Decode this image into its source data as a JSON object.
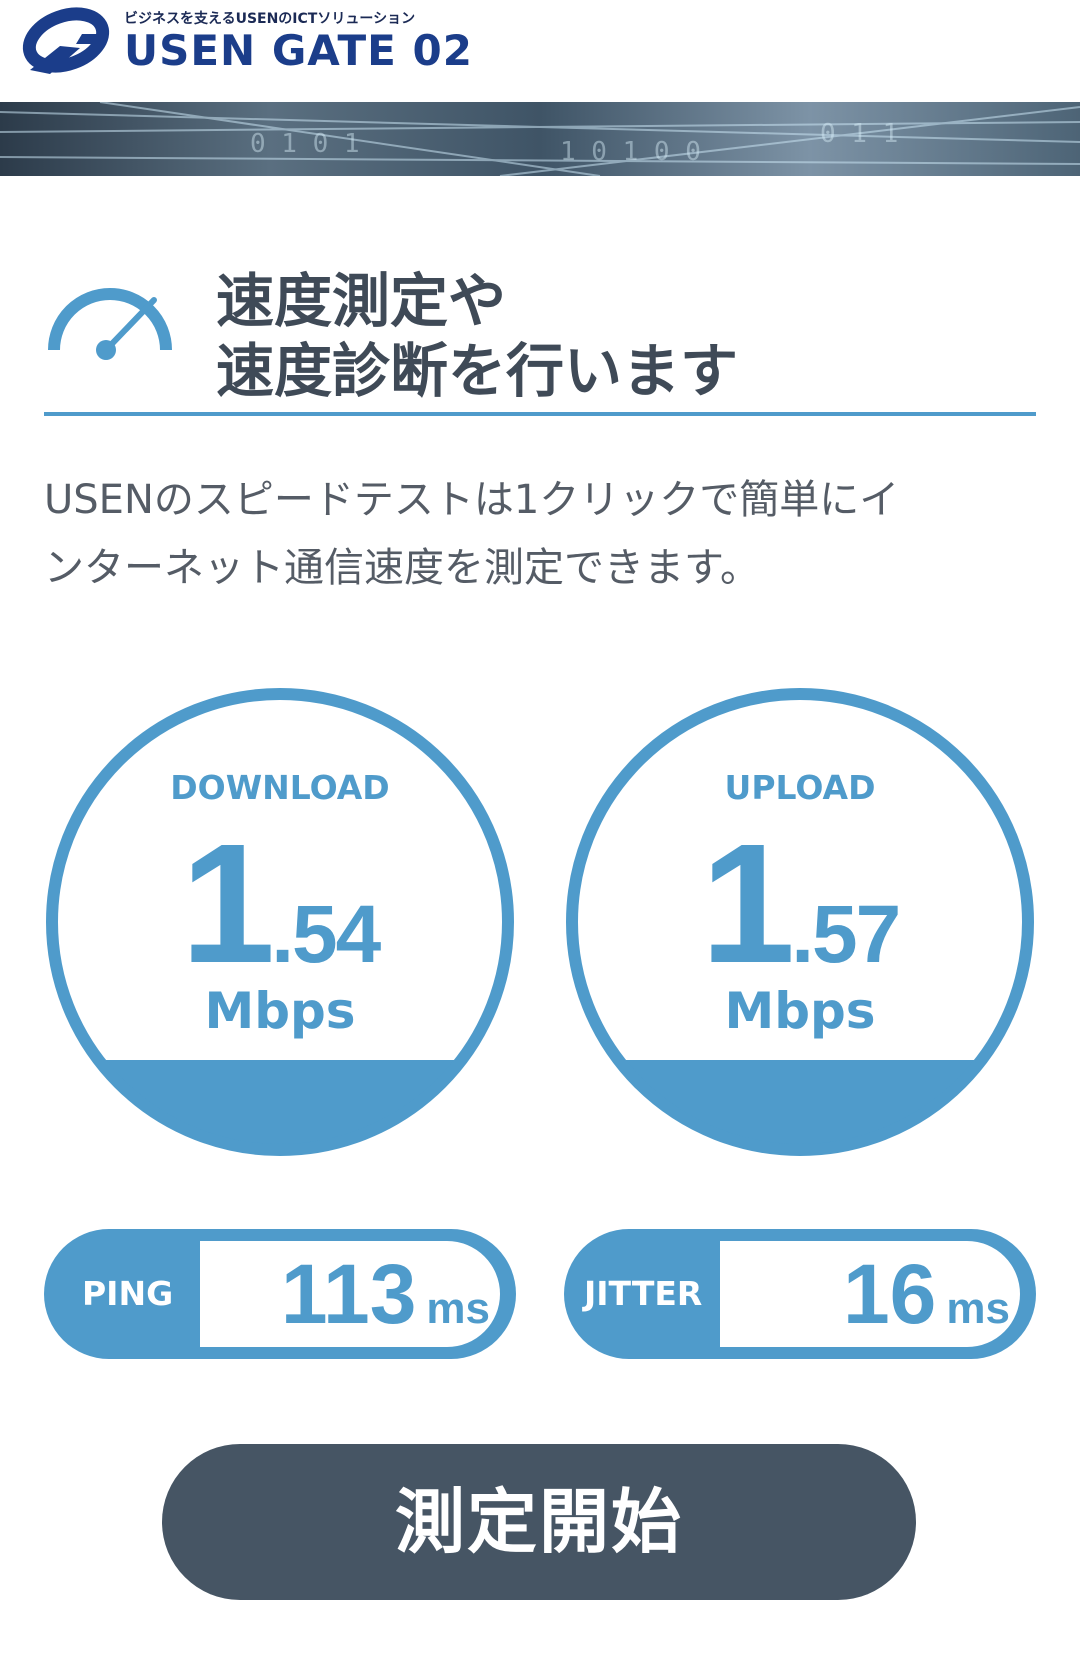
{
  "header": {
    "tagline": "ビジネスを支えるUSENのICTソリューション",
    "brand": "USEN GATE 02"
  },
  "section": {
    "title_line1": "速度測定や",
    "title_line2": "速度診断を行います",
    "description_line1": "USENのスピードテストは1クリックで簡単にイ",
    "description_line2": "ンターネット通信速度を測定できます。"
  },
  "download": {
    "label": "DOWNLOAD",
    "value_int": "1",
    "value_dec": ".54",
    "unit": "Mbps"
  },
  "upload": {
    "label": "UPLOAD",
    "value_int": "1",
    "value_dec": ".57",
    "unit": "Mbps"
  },
  "ping": {
    "label": "PING",
    "value": "113",
    "unit": "ms"
  },
  "jitter": {
    "label": "JITTER",
    "value": "16",
    "unit": "ms"
  },
  "start_button": {
    "label": "測定開始"
  },
  "colors": {
    "accent": "#4f9bcb",
    "button": "#465564",
    "text": "#3f4a57"
  },
  "icons": {
    "logo": "usen-logo-icon",
    "speedometer": "speedometer-icon"
  }
}
